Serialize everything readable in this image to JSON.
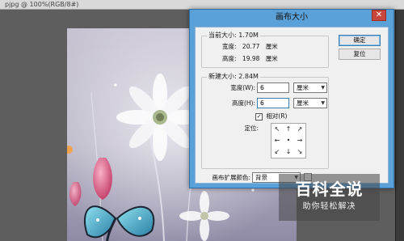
{
  "app": {
    "tab_title": "pjpg @ 100%(RGB/8#)"
  },
  "dialog": {
    "title": "画布大小",
    "close_label": "✕",
    "buttons": {
      "ok": "确定",
      "reset": "复位"
    },
    "current_size": {
      "legend": "当前大小: 1.70M",
      "width_label": "宽度:",
      "width_value": "20.77",
      "width_unit": "厘米",
      "height_label": "高度:",
      "height_value": "19.98",
      "height_unit": "厘米"
    },
    "new_size": {
      "legend": "新建大小: 2.84M",
      "width_label": "宽度(W):",
      "width_value": "6",
      "width_unit": "厘米",
      "height_label": "高度(H):",
      "height_value": "6",
      "height_unit": "厘米",
      "relative_label": "相对(R)",
      "relative_checked": true,
      "anchor_label": "定位:",
      "anchor_arrows": [
        "↖",
        "↑",
        "↗",
        "←",
        "•",
        "→",
        "↙",
        "↓",
        "↘"
      ]
    },
    "extension_color": {
      "label": "画布扩展颜色:",
      "value": "背景"
    }
  },
  "watermark": {
    "title": "百科全说",
    "subtitle": "助你轻松解决"
  },
  "colors": {
    "title_bar": "#5aa1d9",
    "close_button": "#c9463d",
    "workspace": "#5e5e5e"
  }
}
